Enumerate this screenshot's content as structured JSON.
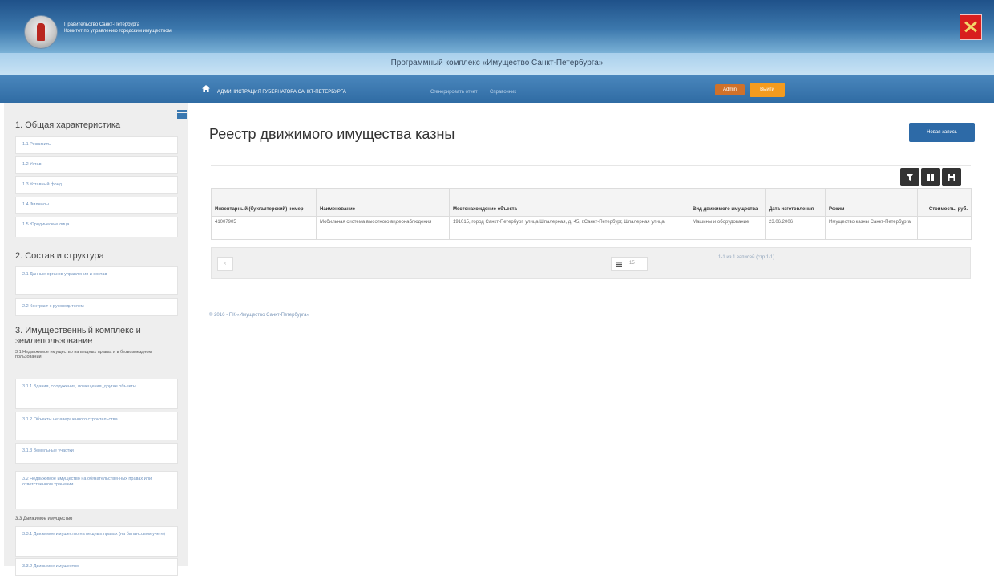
{
  "header": {
    "org_line1": "Правительство Санкт-Петербурга",
    "org_line2": "Комитет по управлению городским имуществом",
    "app_title": "Программный комплекс «Имущество Санкт-Петербурга»",
    "colors": {
      "top": "#1f5189",
      "nav": "#3a78b0",
      "accent": "#f49b1e"
    }
  },
  "nav": {
    "items": [
      "АДМИНИСТРАЦИЯ ГУБЕРНАТОРА САНКТ-ПЕТЕРБУРГА",
      "Сгенерировать отчет",
      "Справочник"
    ],
    "admin_label": "Admin",
    "logout_label": "Выйти"
  },
  "sidebar": {
    "section1_title": "1. Общая характеристика",
    "section1_items": [
      "1.1 Реквизиты",
      "1.2 Устав",
      "1.3 Уставный фонд",
      "1.4 Филиалы",
      "1.5 Юридические лица"
    ],
    "section2_title": "2. Состав и структура",
    "section2_items": [
      "2.1 Данные органов управления и состав",
      "2.2 Контракт с руководителем"
    ],
    "section3_title": "3. Имущественный комплекс и землепользование",
    "section3_1_title": "3.1 Недвижимое имущество на вещных правах и в безвозмездном пользовании",
    "section3_1_items": [
      "3.1.1 Здания, сооружения, помещения, другие объекты",
      "3.1.2 Объекты незавершенного строительства",
      "3.1.3 Земельные участки"
    ],
    "section3_2_item": "3.2 Недвижимое имущество на обязательственных правах или ответственном хранении",
    "section3_3_title": "3.3 Движимое имущество",
    "section3_3_items": [
      "3.3.1 Движимое имущество на вещных правах (на балансовом учете)",
      "3.3.2 Движимое имущество"
    ]
  },
  "main": {
    "title": "Реестр движимого имущества казны",
    "new_button": "Новая запись",
    "columns": [
      "Инвентарный (бухгалтерский) номер",
      "Наименование",
      "Местонахождение объекта",
      "Вид движимого имущества",
      "Дата изготовления",
      "Режим",
      "Стоимость, руб."
    ],
    "rows": [
      [
        "41007905",
        "Мобильная система высотного видеонаблюдения",
        "191015, город Санкт-Петербург, улица Шпалерная, д. 45, г.Санкт-Петербург, Шпалерная улица",
        "Машины и оборудование",
        "23.06.2006",
        "Имущество казны Санкт-Петербурга",
        ""
      ]
    ],
    "pager": {
      "prev": "‹",
      "page_size": "15",
      "info": "1-1 из 1 записей (стр 1/1)"
    },
    "footer": "© 2016 - ПК «Имущество Санкт-Петербурга»"
  },
  "icons": {
    "home": "home-icon",
    "list": "list-icon",
    "filter": "filter-icon",
    "columns": "columns-icon",
    "export": "export-icon"
  }
}
